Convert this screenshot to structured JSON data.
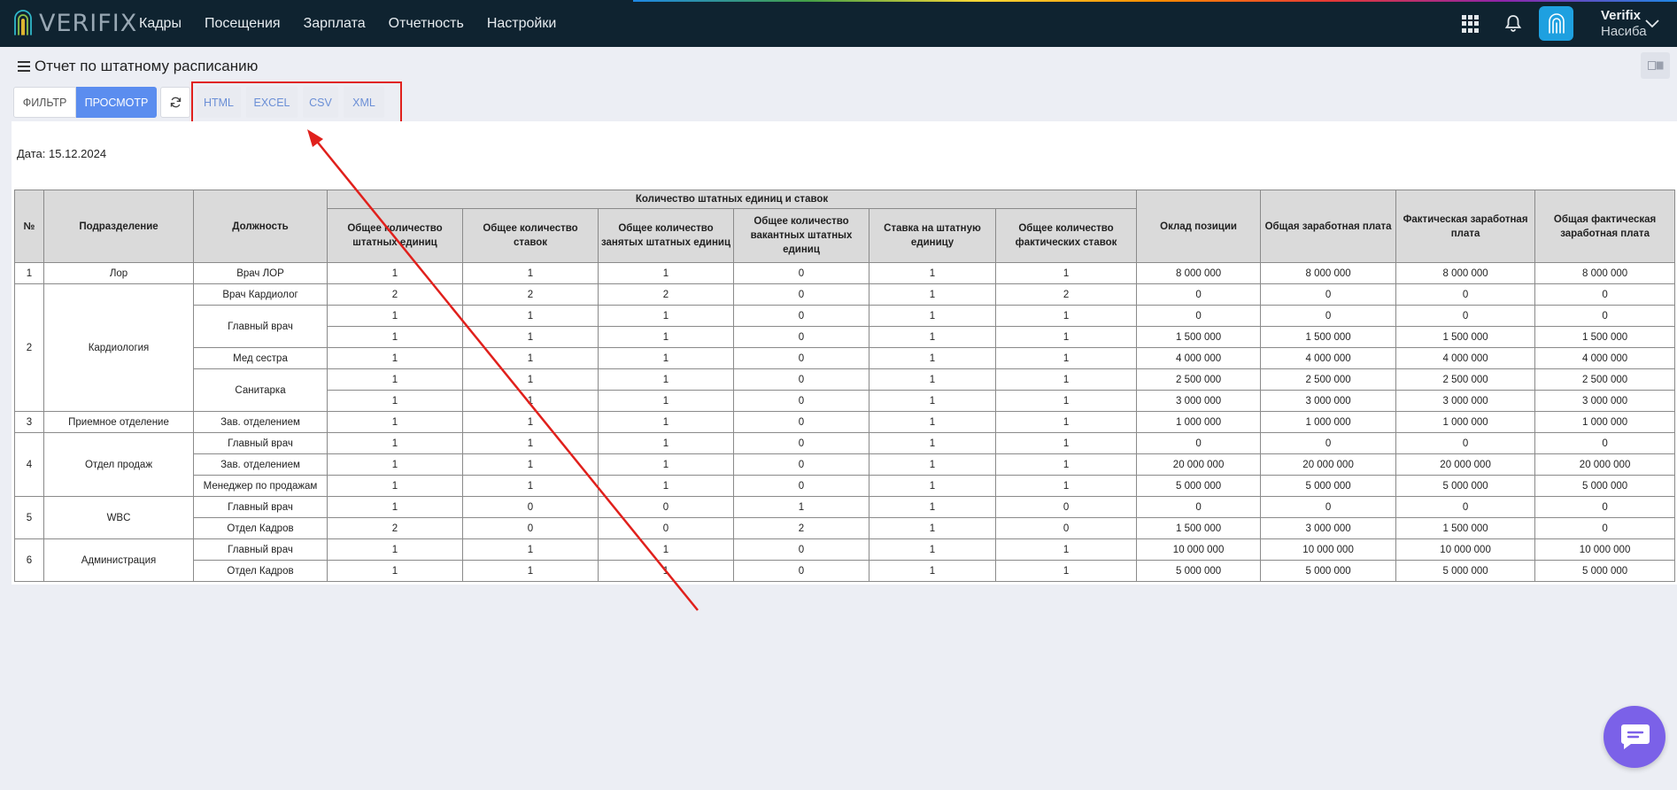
{
  "app": {
    "logo_text": "VERIFIX",
    "nav": [
      "Кадры",
      "Посещения",
      "Зарплата",
      "Отчетность",
      "Настройки"
    ],
    "user_company": "Verifix",
    "user_name": "Насиба",
    "icons": [
      "apps-grid-icon",
      "bell-icon",
      "fingerprint-icon",
      "chevron-down-icon",
      "chat-icon"
    ]
  },
  "page": {
    "title": "Отчет по штатному расписанию",
    "toolbar": {
      "filter": "ФИЛЬТР",
      "view": "ПРОСМОТР",
      "exports": [
        "HTML",
        "EXCEL",
        "CSV",
        "XML"
      ]
    },
    "date_label": "Дата: 15.12.2024"
  },
  "table": {
    "headers": {
      "num": "№",
      "division": "Подразделение",
      "position": "Должность",
      "group": "Количество штатных единиц и ставок",
      "sub": [
        "Общее количество штатных единиц",
        "Общее количество ставок",
        "Общее количество занятых штатных единиц",
        "Общее количество вакантных штатных единиц",
        "Ставка на штатную единицу",
        "Общее количество фактических ставок"
      ],
      "salary": "Оклад позиции",
      "total_salary": "Общая заработная плата",
      "actual_salary": "Фактическая заработная плата",
      "total_actual_salary": "Общая фактическая заработная плата"
    },
    "groups": [
      {
        "num": "1",
        "division": "Лор",
        "positions": [
          {
            "name": "Врач ЛОР",
            "rows": [
              [
                "1",
                "1",
                "1",
                "0",
                "1",
                "1",
                "8 000 000",
                "8 000 000",
                "8 000 000",
                "8 000 000"
              ]
            ]
          }
        ]
      },
      {
        "num": "2",
        "division": "Кардиология",
        "positions": [
          {
            "name": "Врач Кардиолог",
            "rows": [
              [
                "2",
                "2",
                "2",
                "0",
                "1",
                "2",
                "0",
                "0",
                "0",
                "0"
              ]
            ]
          },
          {
            "name": "Главный врач",
            "rows": [
              [
                "1",
                "1",
                "1",
                "0",
                "1",
                "1",
                "0",
                "0",
                "0",
                "0"
              ],
              [
                "1",
                "1",
                "1",
                "0",
                "1",
                "1",
                "1 500 000",
                "1 500 000",
                "1 500 000",
                "1 500 000"
              ]
            ]
          },
          {
            "name": "Мед сестра",
            "rows": [
              [
                "1",
                "1",
                "1",
                "0",
                "1",
                "1",
                "4 000 000",
                "4 000 000",
                "4 000 000",
                "4 000 000"
              ]
            ]
          },
          {
            "name": "Санитарка",
            "rows": [
              [
                "1",
                "1",
                "1",
                "0",
                "1",
                "1",
                "2 500 000",
                "2 500 000",
                "2 500 000",
                "2 500 000"
              ],
              [
                "1",
                "1",
                "1",
                "0",
                "1",
                "1",
                "3 000 000",
                "3 000 000",
                "3 000 000",
                "3 000 000"
              ]
            ]
          }
        ]
      },
      {
        "num": "3",
        "division": "Приемное отделение",
        "positions": [
          {
            "name": "Зав. отделением",
            "rows": [
              [
                "1",
                "1",
                "1",
                "0",
                "1",
                "1",
                "1 000 000",
                "1 000 000",
                "1 000 000",
                "1 000 000"
              ]
            ]
          }
        ]
      },
      {
        "num": "4",
        "division": "Отдел продаж",
        "positions": [
          {
            "name": "Главный врач",
            "rows": [
              [
                "1",
                "1",
                "1",
                "0",
                "1",
                "1",
                "0",
                "0",
                "0",
                "0"
              ]
            ]
          },
          {
            "name": "Зав. отделением",
            "rows": [
              [
                "1",
                "1",
                "1",
                "0",
                "1",
                "1",
                "20 000 000",
                "20 000 000",
                "20 000 000",
                "20 000 000"
              ]
            ]
          },
          {
            "name": "Менеджер по продажам",
            "rows": [
              [
                "1",
                "1",
                "1",
                "0",
                "1",
                "1",
                "5 000 000",
                "5 000 000",
                "5 000 000",
                "5 000 000"
              ]
            ]
          }
        ]
      },
      {
        "num": "5",
        "division": "WBC",
        "positions": [
          {
            "name": "Главный врач",
            "rows": [
              [
                "1",
                "0",
                "0",
                "1",
                "1",
                "0",
                "0",
                "0",
                "0",
                "0"
              ]
            ]
          },
          {
            "name": "Отдел Кадров",
            "rows": [
              [
                "2",
                "0",
                "0",
                "2",
                "1",
                "0",
                "1 500 000",
                "3 000 000",
                "1 500 000",
                "0"
              ]
            ]
          }
        ]
      },
      {
        "num": "6",
        "division": "Администрация",
        "positions": [
          {
            "name": "Главный врач",
            "rows": [
              [
                "1",
                "1",
                "1",
                "0",
                "1",
                "1",
                "10 000 000",
                "10 000 000",
                "10 000 000",
                "10 000 000"
              ]
            ]
          },
          {
            "name": "Отдел Кадров",
            "rows": [
              [
                "1",
                "1",
                "1",
                "0",
                "1",
                "1",
                "5 000 000",
                "5 000 000",
                "5 000 000",
                "5 000 000"
              ]
            ]
          }
        ]
      }
    ]
  },
  "colors": {
    "topbar": "#0f2330",
    "primary_button": "#5b8def",
    "export_link": "#6b8fd6",
    "annotation": "#e0201c",
    "chat_button": "#7b61e8"
  }
}
